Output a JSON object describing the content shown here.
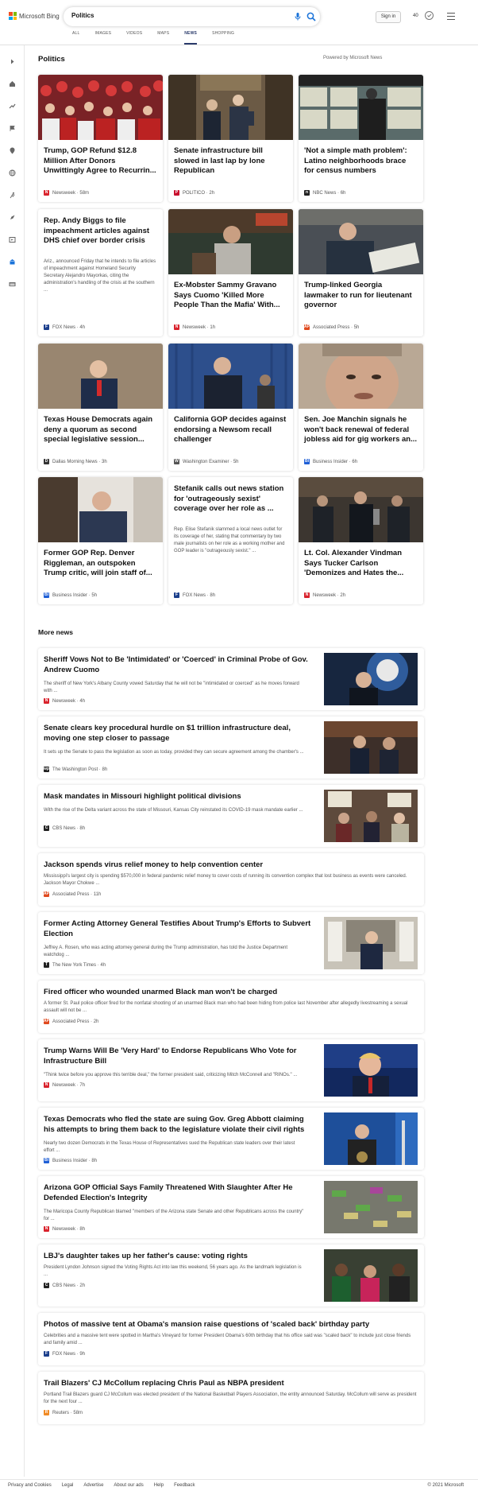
{
  "brand": {
    "name": "Microsoft Bing"
  },
  "search": {
    "query": "Politics"
  },
  "header": {
    "sign_in": "Sign in",
    "rewards_count": "40"
  },
  "tabs": [
    "ALL",
    "IMAGES",
    "VIDEOS",
    "MAPS",
    "NEWS",
    "SHOPPING"
  ],
  "active_tab": "NEWS",
  "section": {
    "title": "Politics",
    "powered_by": "Powered by Microsoft News"
  },
  "cards": [
    {
      "title": "Trump, GOP Refund $12.8 Million After Donors Unwittingly Agree to Recurrin...",
      "source": "Newsweek",
      "time": "58m",
      "icon": "N",
      "icon_color": "#d9232d"
    },
    {
      "title": "Senate infrastructure bill slowed in last lap by lone Republican",
      "source": "POLITICO",
      "time": "2h",
      "icon": "P",
      "icon_color": "#c8102e"
    },
    {
      "title": "'Not a simple math problem': Latino neighborhoods brace for census numbers",
      "source": "NBC News",
      "time": "6h",
      "icon": "n",
      "icon_color": "#222"
    },
    {
      "title": "Rep. Andy Biggs to file impeachment articles against DHS chief over border crisis",
      "description": "Ariz., announced Friday that he intends to file articles of impeachment against Homeland Security Secretary Alejandro Mayorkas, citing the administration's handling of the crisis at the southern ...",
      "source": "FOX News",
      "time": "4h",
      "icon": "F",
      "icon_color": "#1c3f8c"
    },
    {
      "title": "Ex-Mobster Sammy Gravano Says Cuomo 'Killed More People Than the Mafia' With...",
      "source": "Newsweek",
      "time": "1h",
      "icon": "N",
      "icon_color": "#d9232d"
    },
    {
      "title": "Trump-linked Georgia lawmaker to run for lieutenant governor",
      "source": "Associated Press",
      "time": "5h",
      "icon": "AP",
      "icon_color": "#e04a1f"
    },
    {
      "title": "Texas House Democrats again deny a quorum as second special legislative session...",
      "source": "Dallas Morning News",
      "time": "3h",
      "icon": "D",
      "icon_color": "#333"
    },
    {
      "title": "California GOP decides against endorsing a Newsom recall challenger",
      "source": "Washington Examiner",
      "time": "5h",
      "icon": "W",
      "icon_color": "#555"
    },
    {
      "title": "Sen. Joe Manchin signals he won't back renewal of federal jobless aid for gig workers an...",
      "source": "Business Insider",
      "time": "6h",
      "icon": "BI",
      "icon_color": "#1f5fd6"
    },
    {
      "title": "Former GOP Rep. Denver Riggleman, an outspoken Trump critic, will join staff of...",
      "source": "Business Insider",
      "time": "5h",
      "icon": "BI",
      "icon_color": "#1f5fd6"
    },
    {
      "title": "Stefanik calls out news station for 'outrageously sexist' coverage over her role as ...",
      "description": "Rep. Elise Stefanik slammed a local news outlet for its coverage of her, stating that commentary by two male journalists on her role as a working mother and GOP leader is \"outrageously sexist.\" ...",
      "source": "FOX News",
      "time": "8h",
      "icon": "F",
      "icon_color": "#1c3f8c"
    },
    {
      "title": "Lt. Col. Alexander Vindman Says Tucker Carlson 'Demonizes and Hates the...",
      "source": "Newsweek",
      "time": "2h",
      "icon": "N",
      "icon_color": "#d9232d"
    }
  ],
  "more_news": {
    "title": "More news",
    "items": [
      {
        "title": "Sheriff Vows Not to Be 'Intimidated' or 'Coerced' in Criminal Probe of Gov. Andrew Cuomo",
        "description": "The sheriff of New York's Albany County vowed Saturday that he will not be \"intimidated or coerced\" as he moves forward with ...",
        "source": "Newsweek",
        "time": "4h",
        "icon": "N",
        "icon_color": "#d9232d"
      },
      {
        "title": "Senate clears key procedural hurdle on $1 trillion infrastructure deal, moving one step closer to passage",
        "description": "It sets up the Senate to pass the legislation as soon as today, provided they can secure agreement among the chamber's ...",
        "source": "The Washington Post",
        "time": "8h",
        "icon": "wp",
        "icon_color": "#222"
      },
      {
        "title": "Mask mandates in Missouri highlight political divisions",
        "description": "With the rise of the Delta variant across the state of Missouri, Kansas City reinstated its COVID-19 mask mandate earlier ...",
        "source": "CBS News",
        "time": "8h",
        "icon": "C",
        "icon_color": "#222"
      },
      {
        "title": "Jackson spends virus relief money to help convention center",
        "description": "Mississippi's largest city is spending $570,000 in federal pandemic relief money to cover costs of running its convention complex that lost business as events were canceled. Jackson Mayor Chokwe ...",
        "source": "Associated Press",
        "time": "11h",
        "icon": "AP",
        "icon_color": "#e04a1f"
      },
      {
        "title": "Former Acting Attorney General Testifies About Trump's Efforts to Subvert Election",
        "description": "Jeffrey A. Rosen, who was acting attorney general during the Trump administration, has told the Justice Department watchdog ...",
        "source": "The New York Times",
        "time": "4h",
        "icon": "T",
        "icon_color": "#222"
      },
      {
        "title": "Fired officer who wounded unarmed Black man won't be charged",
        "description": "A former St. Paul police officer fired for the nonfatal shooting of an unarmed Black man who had been hiding from police last November after allegedly livestreaming a sexual assault will not be ...",
        "source": "Associated Press",
        "time": "2h",
        "icon": "AP",
        "icon_color": "#e04a1f"
      },
      {
        "title": "Trump Warns Will Be 'Very Hard' to Endorse Republicans Who Vote for Infrastructure Bill",
        "description": "\"Think twice before you approve this terrible deal,\" the former president said, criticizing Mitch McConnell and \"RINOs.\" ...",
        "source": "Newsweek",
        "time": "7h",
        "icon": "N",
        "icon_color": "#d9232d"
      },
      {
        "title": "Texas Democrats who fled the state are suing Gov. Greg Abbott claiming his attempts to bring them back to the legislature violate their civil rights",
        "description": "Nearly two dozen Democrats in the Texas House of Representatives sued the Republican state leaders over their latest effort ...",
        "source": "Business Insider",
        "time": "8h",
        "icon": "BI",
        "icon_color": "#1f5fd6"
      },
      {
        "title": "Arizona GOP Official Says Family Threatened With Slaughter After He Defended Election's Integrity",
        "description": "The Maricopa County Republican blamed \"members of the Arizona state Senate and other Republicans across the country\" for ...",
        "source": "Newsweek",
        "time": "8h",
        "icon": "N",
        "icon_color": "#d9232d"
      },
      {
        "title": "LBJ's daughter takes up her father's cause: voting rights",
        "description": "President Lyndon Johnson signed the Voting Rights Act into law this weekend, 56 years ago. As the landmark legislation is ...",
        "source": "CBS News",
        "time": "2h",
        "icon": "C",
        "icon_color": "#222"
      },
      {
        "title": "Photos of massive tent at Obama's mansion raise questions of 'scaled back' birthday party",
        "description": "Celebrities and a massive tent were spotted in Martha's Vineyard for former President Obama's 60th birthday that his office said was \"scaled back\" to include just close friends and family amid ...",
        "source": "FOX News",
        "time": "9h",
        "icon": "F",
        "icon_color": "#1c3f8c"
      },
      {
        "title": "Trail Blazers' CJ McCollum replacing Chris Paul as NBPA president",
        "description": "Portland Trail Blazers guard CJ McCollum was elected president of the National Basketball Players Association, the entity announced Saturday. McCollum will serve as president for the next four ...",
        "source": "Reuters",
        "time": "58m",
        "icon": "R",
        "icon_color": "#f08a24"
      }
    ]
  },
  "footer": {
    "links": [
      "Privacy and Cookies",
      "Legal",
      "Advertise",
      "About our ads",
      "Help",
      "Feedback"
    ],
    "copyright": "© 2021 Microsoft"
  }
}
